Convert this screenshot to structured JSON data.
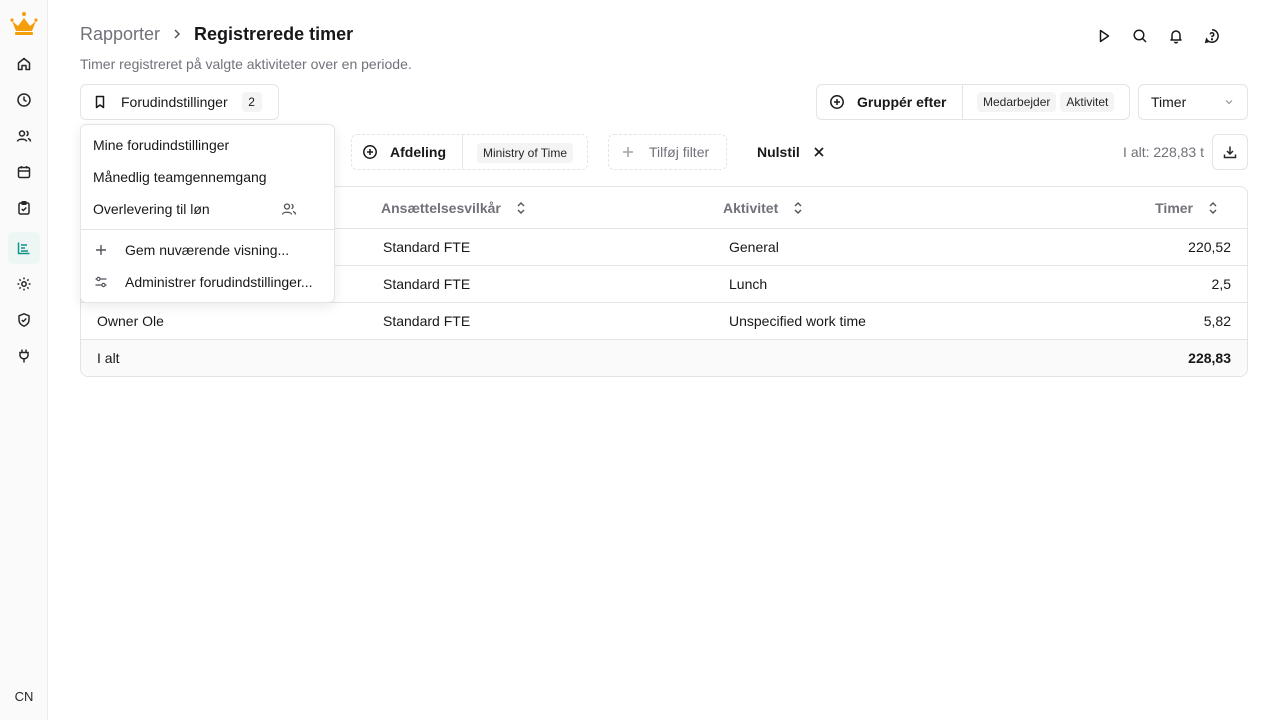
{
  "sidebar": {
    "logo": "crown-logo",
    "items": [
      {
        "icon": "home-icon"
      },
      {
        "icon": "clock-icon"
      },
      {
        "icon": "users-icon"
      },
      {
        "icon": "calendar-icon"
      },
      {
        "icon": "clipboard-check-icon"
      },
      {
        "icon": "chart-bar-icon",
        "active": true
      },
      {
        "icon": "gear-icon"
      },
      {
        "icon": "shield-check-icon"
      },
      {
        "icon": "plug-icon"
      }
    ],
    "avatar_initials": "CN"
  },
  "header": {
    "breadcrumb_parent": "Rapporter",
    "breadcrumb_current": "Registrerede timer",
    "subtitle": "Timer registreret på valgte aktiviteter over en periode.",
    "icons": [
      "play-icon",
      "search-icon",
      "bell-icon",
      "help-circle-icon"
    ]
  },
  "toolbar": {
    "presets_label": "Forudindstillinger",
    "presets_count": "2",
    "group_by_label": "Gruppér efter",
    "group_by_chips": [
      "Medarbejder",
      "Aktivitet"
    ],
    "unit_select": "Timer",
    "department_label": "Afdeling",
    "department_value": "Ministry of Time",
    "add_filter_label": "Tilføj filter",
    "reset_label": "Nulstil",
    "total_label": "I alt: 228,83 t"
  },
  "table": {
    "headers": [
      "",
      "Ansættelsesvilkår",
      "Aktivitet",
      "Timer"
    ],
    "rows": [
      [
        "",
        "Standard FTE",
        "General",
        "220,52"
      ],
      [
        "",
        "Standard FTE",
        "Lunch",
        "2,5"
      ],
      [
        "Owner Ole",
        "Standard FTE",
        "Unspecified work time",
        "5,82"
      ]
    ],
    "footer": [
      "I alt",
      "228,83"
    ]
  },
  "dropdown": {
    "heading": "Mine forudindstillinger",
    "presets": [
      "Månedlig teamgennemgang",
      "Overlevering til løn"
    ],
    "actions": [
      "Gem nuværende visning...",
      "Administrer forudindstillinger..."
    ]
  },
  "colors": {
    "accent": "#0d9488",
    "logo": "#f59e0b",
    "border": "#e4e4e7",
    "muted_text": "#71717a"
  }
}
